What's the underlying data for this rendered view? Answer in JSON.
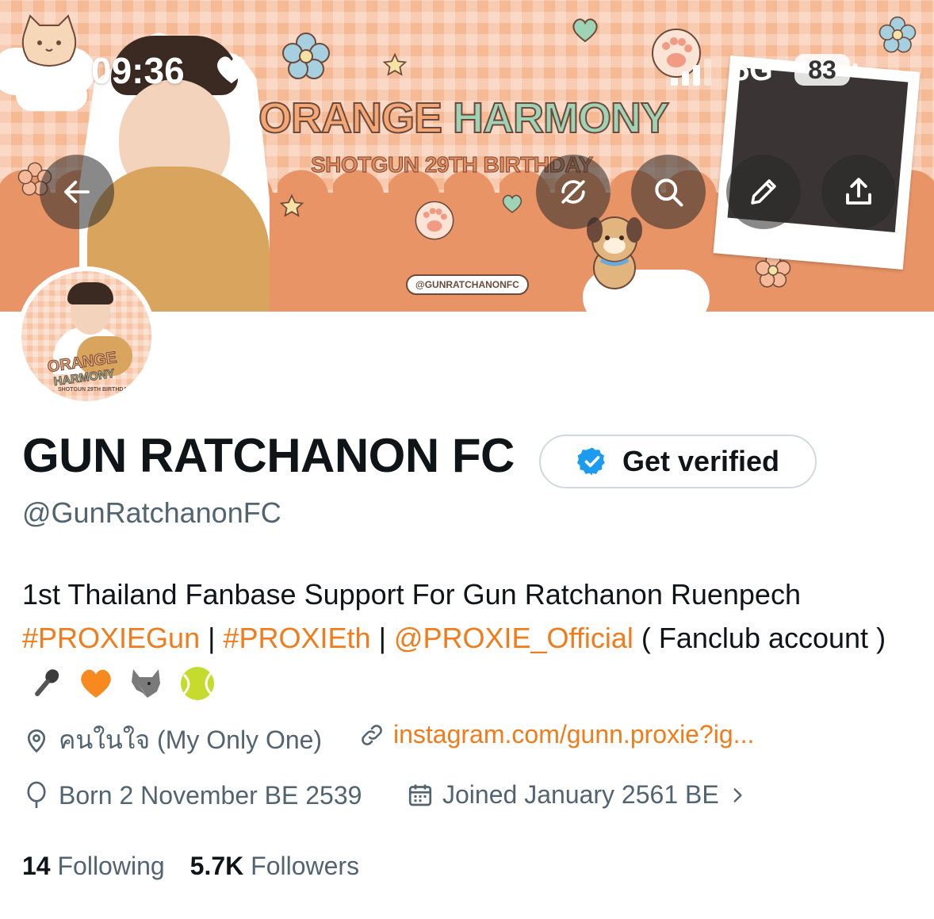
{
  "status_bar": {
    "time": "09:36",
    "network": "5G",
    "battery": "83"
  },
  "banner": {
    "title_part1": "ORANGE",
    "title_part2": "HARMONY",
    "subtitle": "SHOTGUN 29TH BIRTHDAY",
    "handle_tag": "@GUNRATCHANONFC"
  },
  "avatar": {
    "title_part1": "ORANGE",
    "title_part2": "HARMONY",
    "subtitle": "SHOTGUN 29TH BIRTHDAY"
  },
  "profile": {
    "name": "GUN RATCHANON FC",
    "verify_label": "Get verified",
    "handle": "@GunRatchanonFC",
    "bio_line1": "1st Thailand Fanbase Support For Gun Ratchanon Ruenpech",
    "tag1": "#PROXIEGun",
    "separator1": " | ",
    "tag2": "#PROXIEth",
    "separator2": " | ",
    "mention": "@PROXIE_Official",
    "bio_tail": " ( Fanclub account ) ",
    "location": "คนในใจ (My Only One)",
    "website": "instagram.com/gunn.proxie?ig...",
    "born": "Born 2 November BE 2539",
    "joined": "Joined January 2561 BE",
    "following_count": "14",
    "following_label": "Following",
    "followers_count": "5.7K",
    "followers_label": "Followers"
  },
  "colors": {
    "accent_link": "#f07c1b",
    "secondary_text": "#536471",
    "verified_badge": "#1d9bf0",
    "banner_bg": "#f5b994"
  },
  "icons": {
    "back": "arrow-left-icon",
    "sync_off": "sync-off-icon",
    "search": "search-icon",
    "edit": "pencil-icon",
    "share": "share-icon",
    "location": "location-pin-icon",
    "link": "link-icon",
    "birthday": "balloon-icon",
    "calendar": "calendar-icon",
    "verified": "verified-badge-icon",
    "emoji_1": "microphone",
    "emoji_2": "orange-heart",
    "emoji_3": "wolf",
    "emoji_4": "tennis-ball"
  }
}
